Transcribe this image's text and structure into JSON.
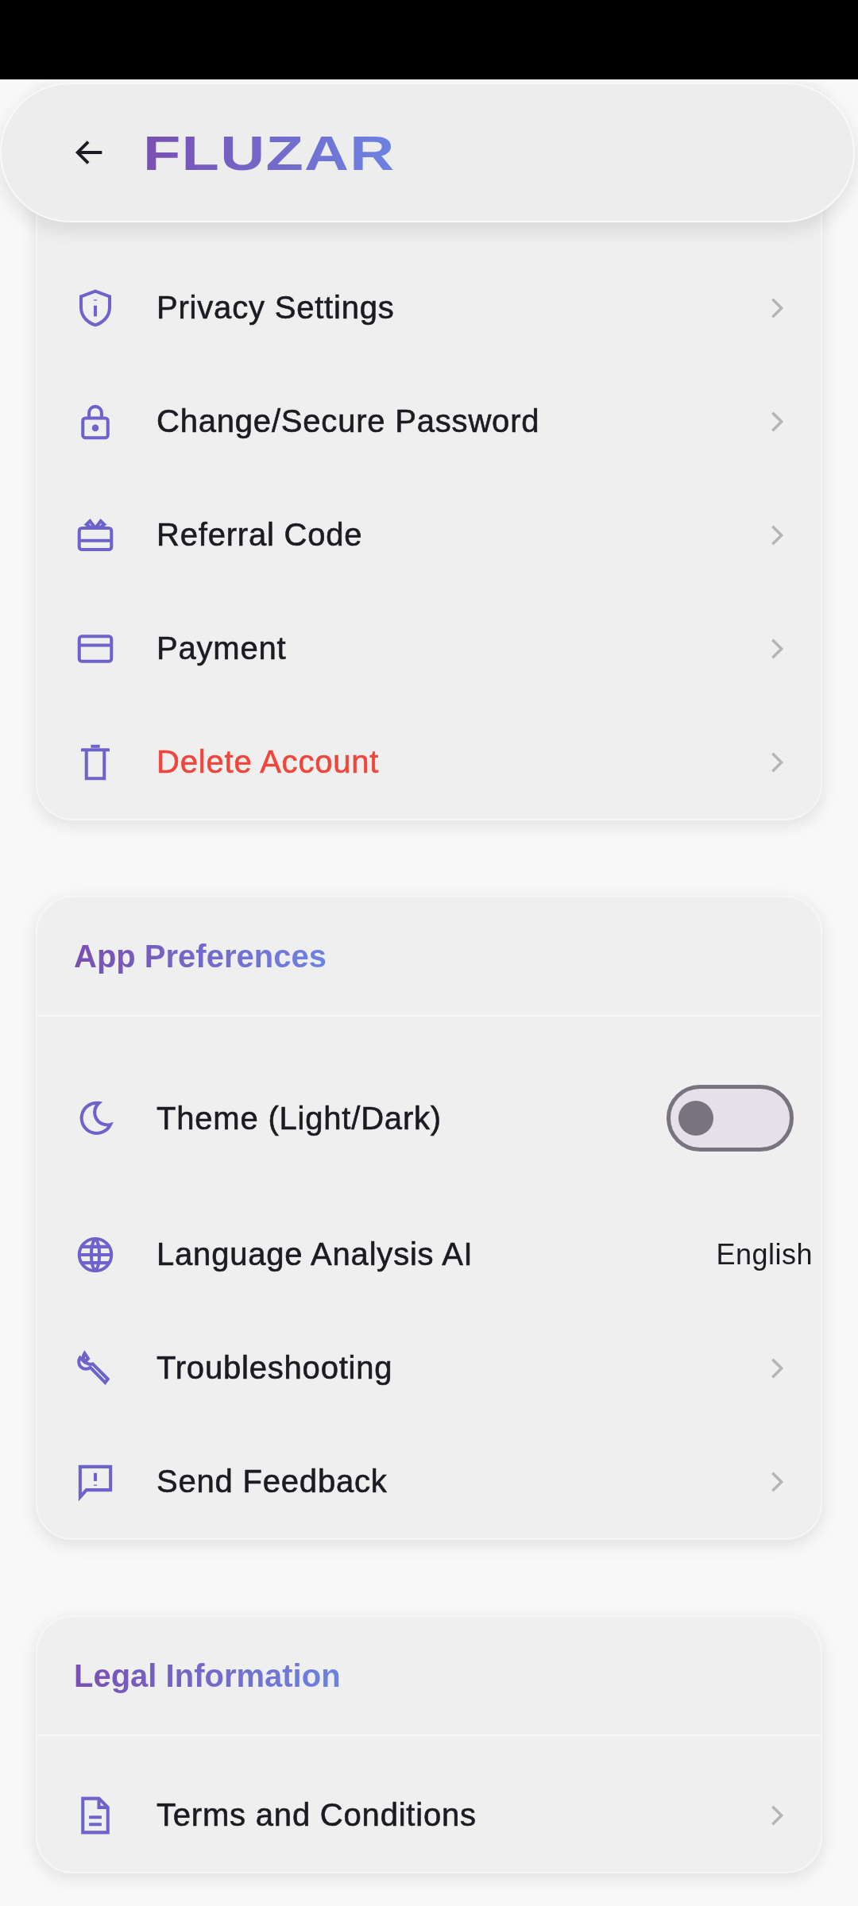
{
  "header": {
    "logo": "FLUZAR"
  },
  "sections": [
    {
      "items": [
        {
          "kind": "link",
          "label": "Privacy Settings",
          "danger": false
        },
        {
          "kind": "link",
          "label": "Change/Secure Password",
          "danger": false
        },
        {
          "kind": "link",
          "label": "Referral Code",
          "danger": false
        },
        {
          "kind": "link",
          "label": "Payment",
          "danger": false
        },
        {
          "kind": "link",
          "label": "Delete Account",
          "danger": true
        }
      ]
    },
    {
      "title": "App Preferences",
      "items": [
        {
          "kind": "toggle",
          "label": "Theme (Light/Dark)",
          "on": false
        },
        {
          "kind": "value",
          "label": "Language Analysis AI",
          "value": "English"
        },
        {
          "kind": "link",
          "label": "Troubleshooting",
          "danger": false
        },
        {
          "kind": "link",
          "label": "Send Feedback",
          "danger": false
        }
      ]
    },
    {
      "title": "Legal Information",
      "items": [
        {
          "kind": "link",
          "label": "Terms and Conditions",
          "danger": false
        }
      ]
    }
  ]
}
